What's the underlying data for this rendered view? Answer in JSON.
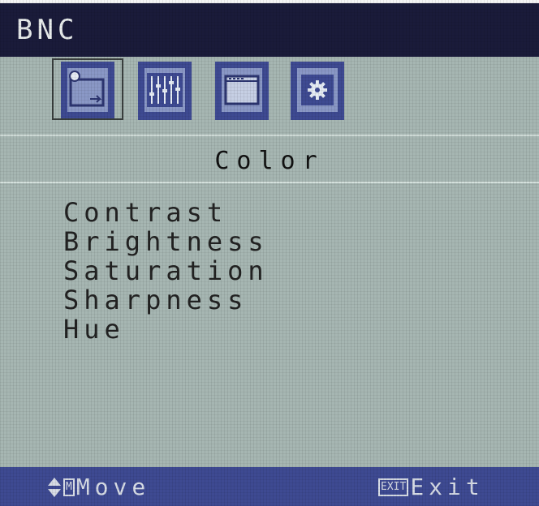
{
  "osd": {
    "source_label": "BNC",
    "tabs": [
      {
        "icon": "picture-adjust-icon",
        "selected": true
      },
      {
        "icon": "equalizer-sliders-icon",
        "selected": false
      },
      {
        "icon": "window-screen-icon",
        "selected": false
      },
      {
        "icon": "gear-settings-icon",
        "selected": false
      }
    ],
    "section_title": "Color",
    "menu_items": [
      "Contrast",
      "Brightness",
      "Saturation",
      "Sharpness",
      "Hue"
    ],
    "footer": {
      "move_key": "M",
      "move_label": "Move",
      "exit_key": "EXIT",
      "exit_label": "Exit"
    }
  },
  "colors": {
    "title_bar": "#1a1b3a",
    "background": "#a6b6b2",
    "accent": "#3e4a92"
  }
}
